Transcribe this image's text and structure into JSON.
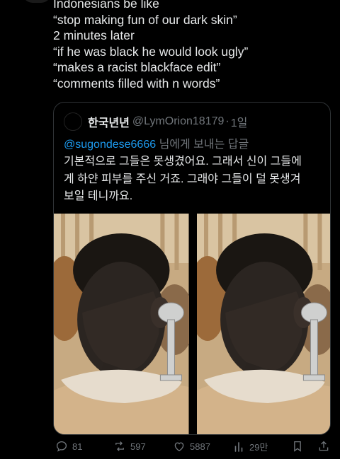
{
  "post": {
    "lines": [
      "Indonesians be like",
      "“stop making fun of our dark skin”",
      "2 minutes later",
      "“if he was black he would look ugly”",
      "“makes a racist blackface edit”",
      "“comments filled with n words”"
    ]
  },
  "quote": {
    "display_name": "한국년년",
    "handle": "@LymOrion18179",
    "separator": "·",
    "time": "1일",
    "reply_mention": "@sugondese6666",
    "reply_suffix": " 님에게 보내는 답글",
    "body_lines": [
      "기본적으로 그들은 못생겼어요. 그래서 신이 그들에",
      "게 하얀 피부를 주신 거죠. 그래야 그들이 덜 못생겨",
      "보일 테니까요."
    ],
    "media": [
      "photo-left",
      "photo-right"
    ]
  },
  "actions": {
    "replies": "81",
    "reposts": "597",
    "likes": "5887",
    "views": "29만"
  },
  "colors": {
    "background": "#000000",
    "text": "#e7e9ea",
    "muted": "#71767b",
    "link": "#1d9bf0",
    "border": "#2f3336"
  }
}
